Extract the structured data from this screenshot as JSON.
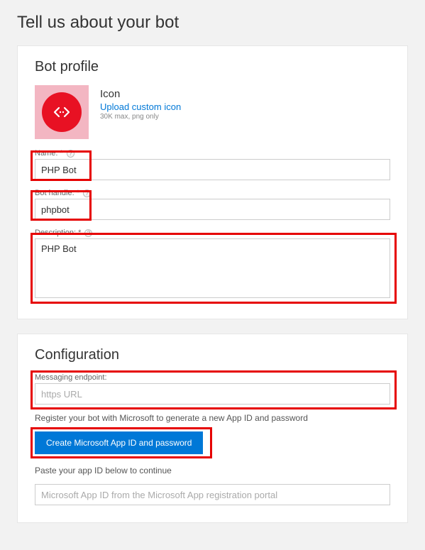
{
  "page_title": "Tell us about your bot",
  "profile": {
    "heading": "Bot profile",
    "icon_title": "Icon",
    "upload_link": "Upload custom icon",
    "upload_hint": "30K max, png only",
    "name_label": "Name: *",
    "name_value": "PHP Bot",
    "handle_label": "Bot handle: *",
    "handle_value": "phpbot",
    "description_label": "Description: *",
    "description_value": "PHP Bot"
  },
  "config": {
    "heading": "Configuration",
    "endpoint_label": "Messaging endpoint:",
    "endpoint_placeholder": "https URL",
    "register_text": "Register your bot with Microsoft to generate a new App ID and password",
    "create_button": "Create Microsoft App ID and password",
    "paste_text": "Paste your app ID below to continue",
    "appid_placeholder": "Microsoft App ID from the Microsoft App registration portal"
  }
}
